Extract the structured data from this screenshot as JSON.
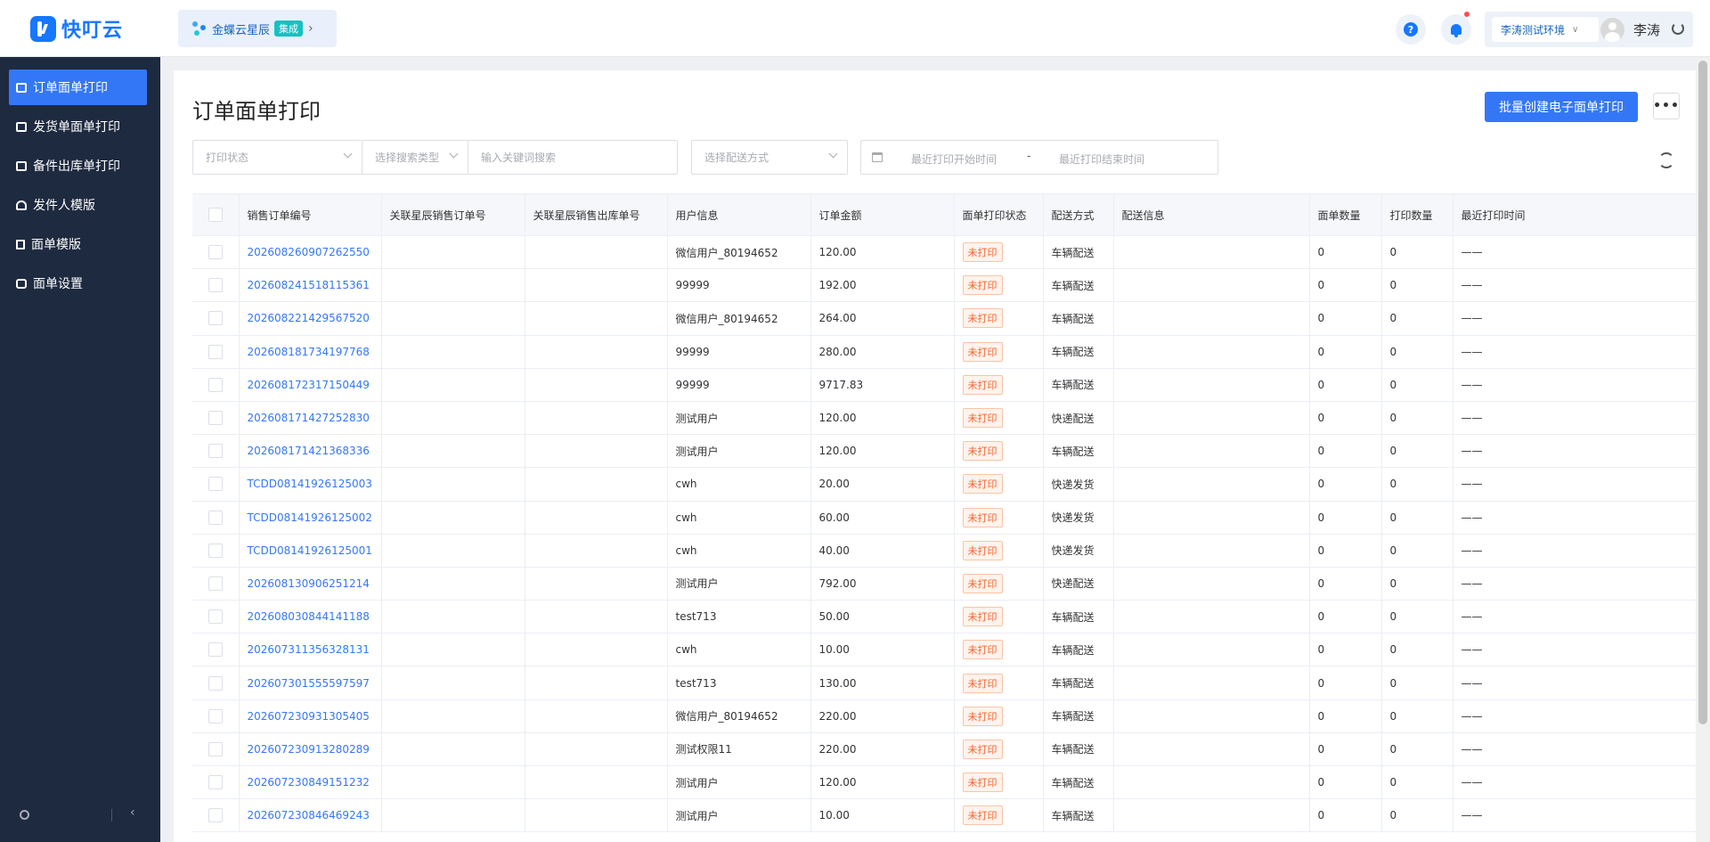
{
  "header": {
    "logo_text": "快叮云",
    "app_chip": {
      "name": "金蝶云星辰",
      "badge": "集成"
    },
    "env_select": "李涛测试环境",
    "user_name": "李涛",
    "help_glyph": "?"
  },
  "sidebar": {
    "items": [
      {
        "label": "订单面单打印",
        "icon": "printer-icon",
        "active": true
      },
      {
        "label": "发货单面单打印",
        "icon": "printer-icon"
      },
      {
        "label": "备件出库单打印",
        "icon": "printer-icon"
      },
      {
        "label": "发件人模版",
        "icon": "person-icon"
      },
      {
        "label": "面单模版",
        "icon": "document-icon"
      },
      {
        "label": "面单设置",
        "icon": "cube-icon"
      }
    ]
  },
  "page": {
    "title": "订单面单打印",
    "batch_button": "批量创建电子面单打印",
    "more_glyph": "•••"
  },
  "filters": {
    "print_status": "打印状态",
    "search_type": "选择搜索类型",
    "keyword": "输入关键词搜索",
    "delivery": "选择配送方式",
    "date_start": "最近打印开始时间",
    "date_sep": "-",
    "date_end": "最近打印结束时间"
  },
  "table": {
    "columns": [
      "销售订单编号",
      "关联星辰销售订单号",
      "关联星辰销售出库单号",
      "用户信息",
      "订单金额",
      "面单打印状态",
      "配送方式",
      "配送信息",
      "面单数量",
      "打印数量",
      "最近打印时间"
    ],
    "rows": [
      {
        "order_no": "202608260907262550",
        "user": "微信用户_80194652",
        "amount": "120.00",
        "status": "未打印",
        "delivery": "车辆配送",
        "sheet_qty": "0",
        "print_qty": "0",
        "last_print": "——"
      },
      {
        "order_no": "202608241518115361",
        "user": "99999",
        "amount": "192.00",
        "status": "未打印",
        "delivery": "车辆配送",
        "sheet_qty": "0",
        "print_qty": "0",
        "last_print": "——"
      },
      {
        "order_no": "202608221429567520",
        "user": "微信用户_80194652",
        "amount": "264.00",
        "status": "未打印",
        "delivery": "车辆配送",
        "sheet_qty": "0",
        "print_qty": "0",
        "last_print": "——"
      },
      {
        "order_no": "202608181734197768",
        "user": "99999",
        "amount": "280.00",
        "status": "未打印",
        "delivery": "车辆配送",
        "sheet_qty": "0",
        "print_qty": "0",
        "last_print": "——"
      },
      {
        "order_no": "202608172317150449",
        "user": "99999",
        "amount": "9717.83",
        "status": "未打印",
        "delivery": "车辆配送",
        "sheet_qty": "0",
        "print_qty": "0",
        "last_print": "——"
      },
      {
        "order_no": "202608171427252830",
        "user": "测试用户",
        "amount": "120.00",
        "status": "未打印",
        "delivery": "快递配送",
        "sheet_qty": "0",
        "print_qty": "0",
        "last_print": "——"
      },
      {
        "order_no": "202608171421368336",
        "user": "测试用户",
        "amount": "120.00",
        "status": "未打印",
        "delivery": "车辆配送",
        "sheet_qty": "0",
        "print_qty": "0",
        "last_print": "——"
      },
      {
        "order_no": "TCDD08141926125003",
        "user": "cwh",
        "amount": "20.00",
        "status": "未打印",
        "delivery": "快递发货",
        "sheet_qty": "0",
        "print_qty": "0",
        "last_print": "——"
      },
      {
        "order_no": "TCDD08141926125002",
        "user": "cwh",
        "amount": "60.00",
        "status": "未打印",
        "delivery": "快递发货",
        "sheet_qty": "0",
        "print_qty": "0",
        "last_print": "——"
      },
      {
        "order_no": "TCDD08141926125001",
        "user": "cwh",
        "amount": "40.00",
        "status": "未打印",
        "delivery": "快递发货",
        "sheet_qty": "0",
        "print_qty": "0",
        "last_print": "——"
      },
      {
        "order_no": "202608130906251214",
        "user": "测试用户",
        "amount": "792.00",
        "status": "未打印",
        "delivery": "快递配送",
        "sheet_qty": "0",
        "print_qty": "0",
        "last_print": "——"
      },
      {
        "order_no": "202608030844141188",
        "user": "test713",
        "amount": "50.00",
        "status": "未打印",
        "delivery": "车辆配送",
        "sheet_qty": "0",
        "print_qty": "0",
        "last_print": "——"
      },
      {
        "order_no": "202607311356328131",
        "user": "cwh",
        "amount": "10.00",
        "status": "未打印",
        "delivery": "车辆配送",
        "sheet_qty": "0",
        "print_qty": "0",
        "last_print": "——"
      },
      {
        "order_no": "202607301555597597",
        "user": "test713",
        "amount": "130.00",
        "status": "未打印",
        "delivery": "车辆配送",
        "sheet_qty": "0",
        "print_qty": "0",
        "last_print": "——"
      },
      {
        "order_no": "202607230931305405",
        "user": "微信用户_80194652",
        "amount": "220.00",
        "status": "未打印",
        "delivery": "车辆配送",
        "sheet_qty": "0",
        "print_qty": "0",
        "last_print": "——"
      },
      {
        "order_no": "202607230913280289",
        "user": "测试权限11",
        "amount": "220.00",
        "status": "未打印",
        "delivery": "车辆配送",
        "sheet_qty": "0",
        "print_qty": "0",
        "last_print": "——"
      },
      {
        "order_no": "202607230849151232",
        "user": "测试用户",
        "amount": "120.00",
        "status": "未打印",
        "delivery": "车辆配送",
        "sheet_qty": "0",
        "print_qty": "0",
        "last_print": "——"
      },
      {
        "order_no": "202607230846469243",
        "user": "测试用户",
        "amount": "10.00",
        "status": "未打印",
        "delivery": "车辆配送",
        "sheet_qty": "0",
        "print_qty": "0",
        "last_print": "——"
      }
    ]
  },
  "colors": {
    "brand": "#1677ff",
    "primary": "#3477f6",
    "sidebar_bg": "#1e2a3f",
    "status_unprinted": "#f5622d"
  }
}
